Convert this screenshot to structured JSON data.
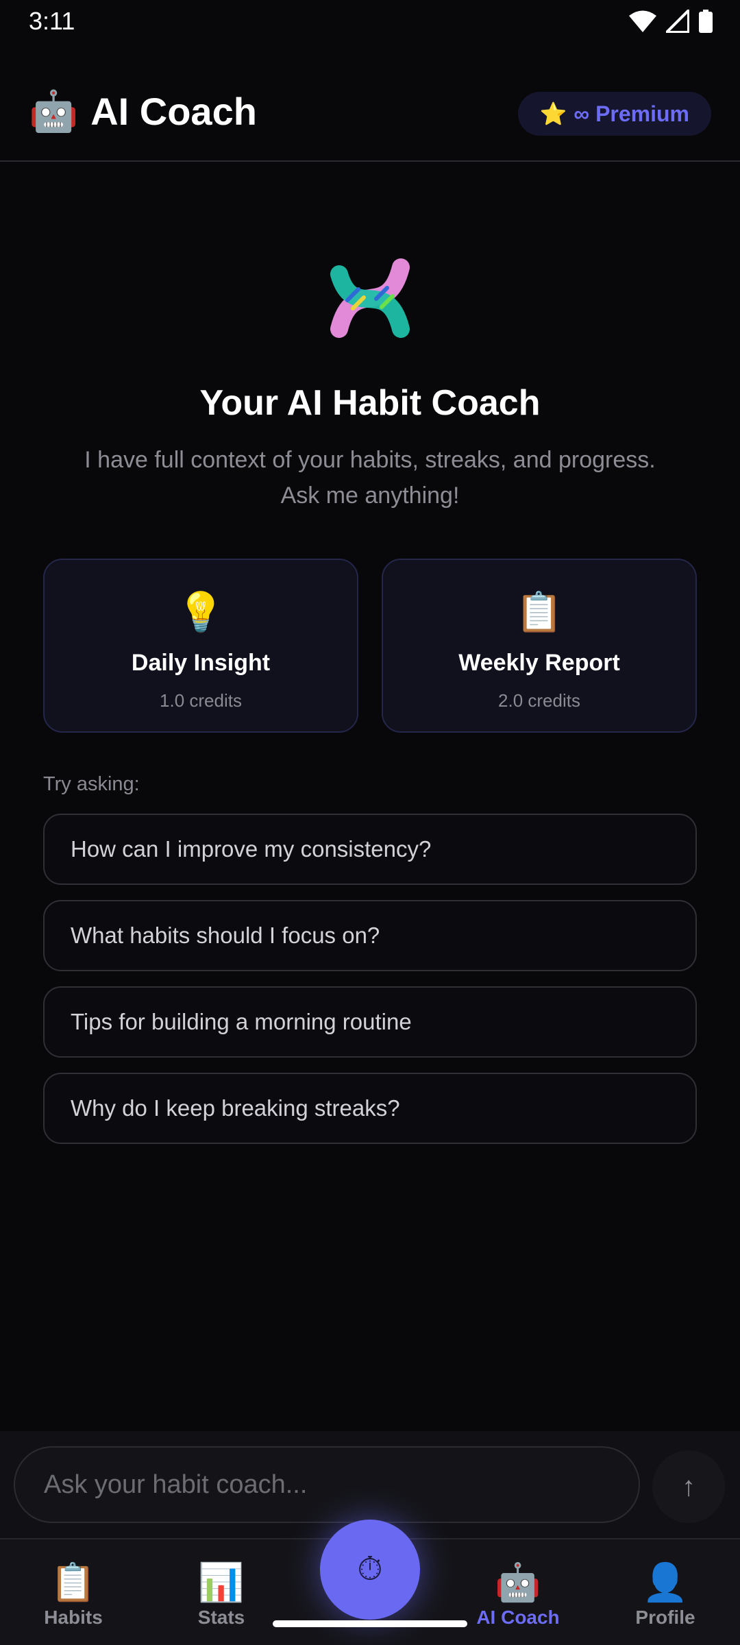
{
  "status_bar": {
    "time": "3:11"
  },
  "header": {
    "emoji": "🤖",
    "title": "AI Coach",
    "premium_star": "⭐",
    "premium_label": "∞ Premium"
  },
  "hero": {
    "icon": "dna-icon",
    "title": "Your AI Habit Coach",
    "subtitle_line1": "I have full context of your habits, streaks, and progress.",
    "subtitle_line2": "Ask me anything!"
  },
  "cards": [
    {
      "emoji": "💡",
      "title": "Daily Insight",
      "credits": "1.0 credits"
    },
    {
      "emoji": "📋",
      "title": "Weekly Report",
      "credits": "2.0 credits"
    }
  ],
  "suggestions": {
    "label": "Try asking:",
    "items": [
      "How can I improve my consistency?",
      "What habits should I focus on?",
      "Tips for building a morning routine",
      "Why do I keep breaking streaks?"
    ]
  },
  "chat": {
    "placeholder": "Ask your habit coach...",
    "send_glyph": "↑"
  },
  "nav": {
    "items": [
      {
        "emoji": "📋",
        "label": "Habits"
      },
      {
        "emoji": "📊",
        "label": "Stats"
      },
      {
        "emoji": "🤖",
        "label": "AI Coach"
      },
      {
        "emoji": "👤",
        "label": "Profile"
      }
    ],
    "fab_glyph": "⏱"
  },
  "colors": {
    "accent": "#6d6cf5",
    "background": "#08080b",
    "card_bg": "#10111d"
  }
}
